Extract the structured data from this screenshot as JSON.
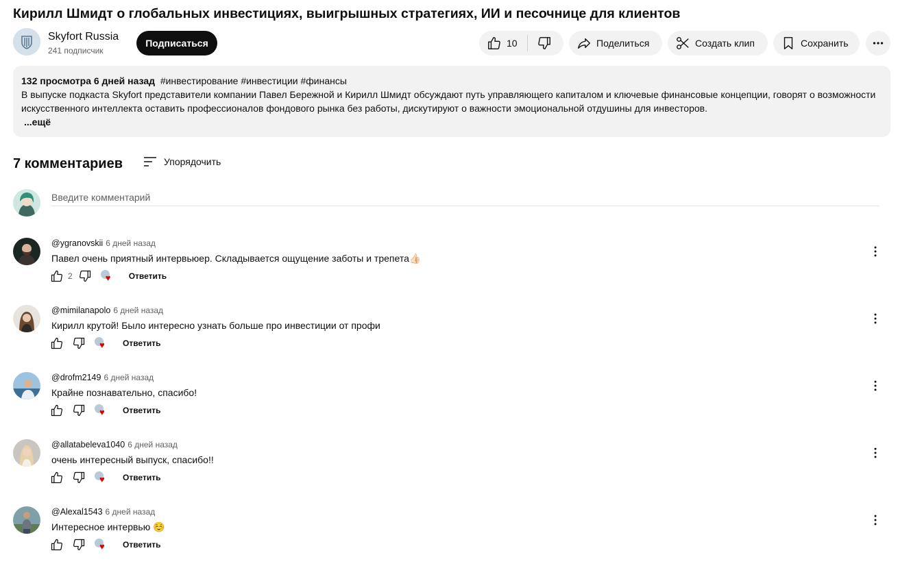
{
  "video": {
    "title": "Кирилл Шмидт о глобальных инвестициях, выигрышных стратегиях, ИИ и песочнице для клиентов"
  },
  "channel": {
    "name": "Skyfort Russia",
    "subscribers": "241 подписчик",
    "subscribe_label": "Подписаться",
    "avatar_icon": "shield-logo-icon"
  },
  "actions": {
    "like_count": "10",
    "share_label": "Поделиться",
    "clip_label": "Создать клип",
    "save_label": "Сохранить"
  },
  "description": {
    "meta": "132 просмотра  6 дней назад",
    "tags": "#инвестирование #инвестиции #финансы",
    "text": "В выпуске подкаста Skyfort представители компании Павел Бережной и Кирилл Шмидт обсуждают путь управляющего капиталом и ключевые финансовые концепции, говорят о возможности искусственного интеллекта оставить профессионалов фондового рынка без работы, дискутируют о важности эмоциональной отдушины для инвесторов.",
    "more_label": "...ещё"
  },
  "comments_section": {
    "count_label": "7 комментариев",
    "sort_label": "Упорядочить",
    "input_placeholder": "Введите комментарий"
  },
  "comments": [
    {
      "author": "@ygranovskii",
      "time": "6 дней назад",
      "text": "Павел очень приятный интервьюер. Складывается ощущение заботы и трепета👍🏻",
      "likes": "2",
      "reply": "Ответить"
    },
    {
      "author": "@mimilanapolo",
      "time": "6 дней назад",
      "text": "Кирилл крутой! Было интересно узнать больше про инвестиции от профи",
      "likes": "",
      "reply": "Ответить"
    },
    {
      "author": "@drofm2149",
      "time": "6 дней назад",
      "text": "Крайне познавательно, спасибо!",
      "likes": "",
      "reply": "Ответить"
    },
    {
      "author": "@allatabeleva1040",
      "time": "6 дней назад",
      "text": "очень интересный выпуск, спасибо!!",
      "likes": "",
      "reply": "Ответить"
    },
    {
      "author": "@Alexal1543",
      "time": "6 дней назад",
      "text": "Интересное интервью ☺️",
      "likes": "",
      "reply": "Ответить"
    }
  ],
  "colors": {
    "accent": "#0f0f0f",
    "pill_bg": "#f2f2f2",
    "secondary_text": "#606060",
    "heart": "#e00000"
  }
}
